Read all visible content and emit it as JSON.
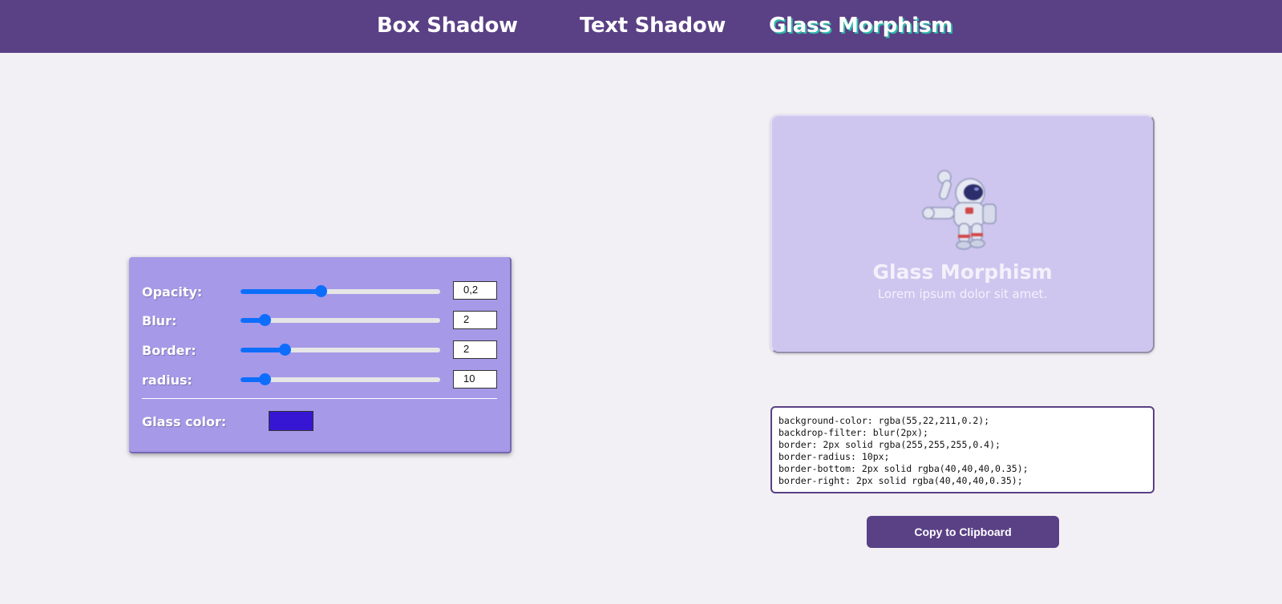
{
  "nav": {
    "box_shadow": "Box Shadow",
    "text_shadow": "Text Shadow",
    "glass_morphism": "Glass Morphism",
    "active": "glass_morphism"
  },
  "controls": {
    "opacity": {
      "label": "Opacity:",
      "value": "0,2",
      "level": 0.4
    },
    "blur": {
      "label": "Blur:",
      "value": "2",
      "level": 0.12
    },
    "border": {
      "label": "Border:",
      "value": "2",
      "level": 0.22
    },
    "radius": {
      "label": "radius:",
      "value": "10",
      "level": 0.12
    },
    "glass_color": {
      "label": "Glass color:",
      "color": "#3716d3"
    }
  },
  "preview": {
    "title": "Glass Morphism",
    "subtitle": "Lorem ipsum dolor sit amet."
  },
  "code": "background-color: rgba(55,22,211,0.2);\nbackdrop-filter: blur(2px);\nborder: 2px solid rgba(255,255,255,0.4);\nborder-radius: 10px;\nborder-bottom: 2px solid rgba(40,40,40,0.35);\nborder-right: 2px solid rgba(40,40,40,0.35);",
  "copy_button": "Copy to Clipboard",
  "colors": {
    "nav_bg": "#5a4085",
    "accent": "#0d6efd",
    "panel_bg": "#a699e8",
    "preview_bg": "#cfc6ef",
    "active_shadow": "#2fb8a8"
  },
  "icons": {
    "preview_image": "astronaut-icon"
  }
}
